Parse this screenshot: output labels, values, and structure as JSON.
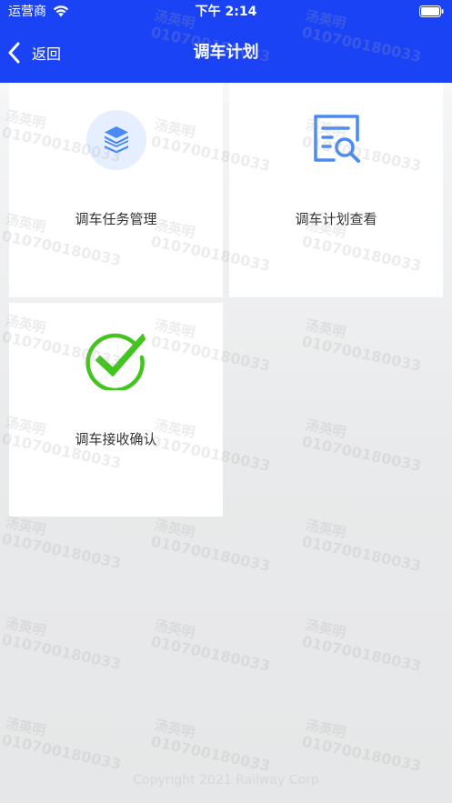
{
  "status_bar": {
    "carrier": "运营商",
    "time": "下午 2:14"
  },
  "header": {
    "back_label": "返回",
    "title": "调车计划"
  },
  "cards": [
    {
      "label": "调车任务管理",
      "icon": "stack-layers-icon"
    },
    {
      "label": "调车计划查看",
      "icon": "document-search-icon"
    },
    {
      "label": "调车接收确认",
      "icon": "checkmark-circle-icon"
    }
  ],
  "watermark": {
    "name": "汤英明",
    "id": "010700180033"
  },
  "footer": {
    "text": "Copyright 2021 Railway Corp"
  },
  "colors": {
    "header_bg": "#1a43f5",
    "icon_blue": "#4a8af4",
    "icon_green": "#43c41f"
  }
}
